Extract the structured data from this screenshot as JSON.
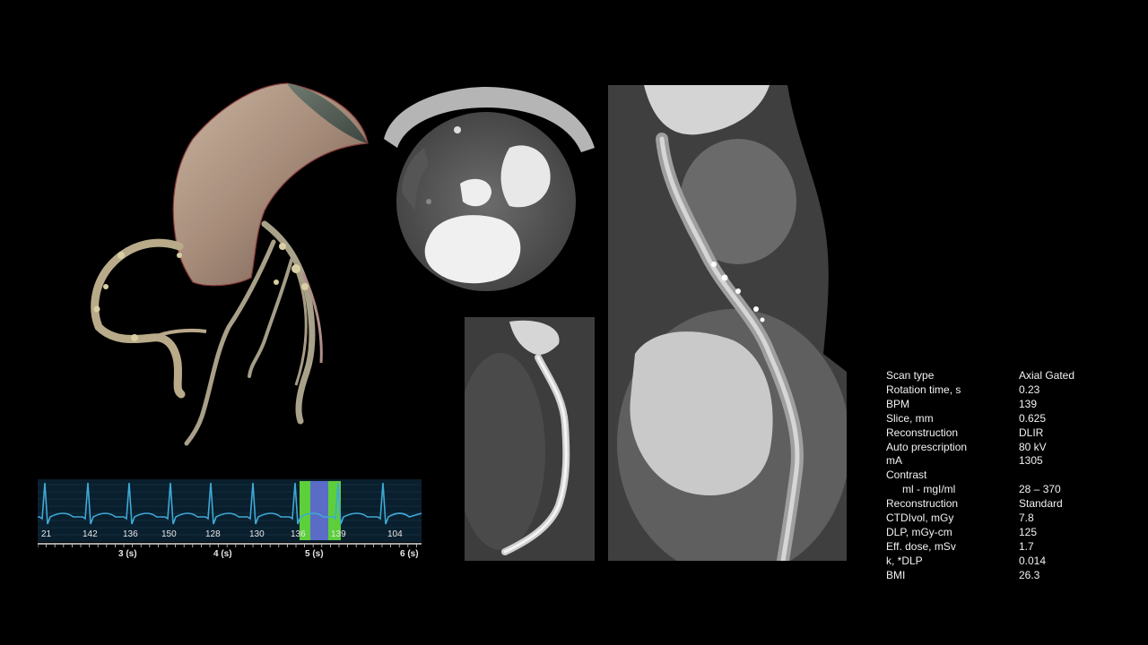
{
  "ecg": {
    "bpm_labels": [
      "21",
      "142",
      "136",
      "150",
      "128",
      "130",
      "136",
      "139",
      "104"
    ],
    "time_labels": [
      "3 (s)",
      "4 (s)",
      "5 (s)",
      "6 (s)"
    ],
    "colors": {
      "trace": "#3fa9d6",
      "window": "#5ccf3a",
      "highlight": "#5a5ae0"
    }
  },
  "scan_parameters": [
    {
      "label": "Scan type",
      "value": "Axial Gated"
    },
    {
      "label": "Rotation time, s",
      "value": "0.23"
    },
    {
      "label": "BPM",
      "value": "139"
    },
    {
      "label": "Slice, mm",
      "value": "0.625"
    },
    {
      "label": "Reconstruction",
      "value": "DLIR"
    },
    {
      "label": "Auto prescription",
      "value": "80 kV"
    },
    {
      "label": "mA",
      "value": "1305"
    },
    {
      "label": "Contrast",
      "value": ""
    },
    {
      "label": "ml - mgI/ml",
      "value": "28 – 370",
      "indent": true
    },
    {
      "label": "Reconstruction",
      "value": "Standard"
    },
    {
      "label": "CTDIvol, mGy",
      "value": "7.8"
    },
    {
      "label": "DLP, mGy-cm",
      "value": "125"
    },
    {
      "label": "Eff. dose, mSv",
      "value": "1.7"
    },
    {
      "label": "k, *DLP",
      "value": "0.014"
    },
    {
      "label": "BMI",
      "value": "26.3"
    }
  ]
}
